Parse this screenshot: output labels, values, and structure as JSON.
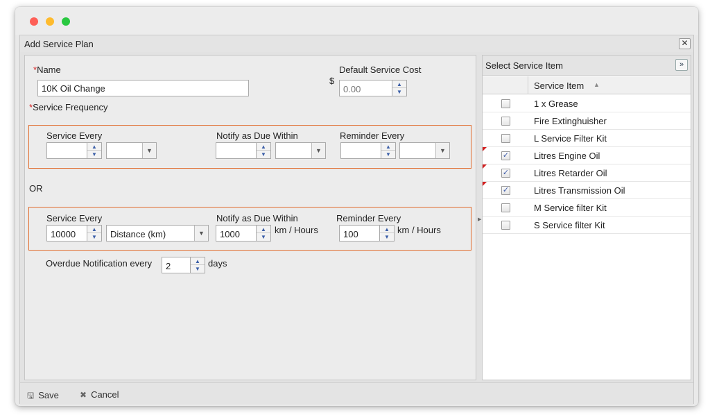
{
  "dialog": {
    "title": "Add Service Plan"
  },
  "name_field": {
    "label": "Name",
    "value": "10K Oil Change"
  },
  "cost_field": {
    "label": "Default Service Cost",
    "currency": "$",
    "value": "0.00"
  },
  "frequency_label": "Service Frequency",
  "or_label": "OR",
  "freq_time": {
    "service_every_label": "Service Every",
    "service_every_value": "",
    "service_unit_value": "",
    "notify_label": "Notify as Due Within",
    "notify_value": "",
    "notify_unit_value": "",
    "reminder_label": "Reminder Every",
    "reminder_value": "",
    "reminder_unit_value": ""
  },
  "freq_distance": {
    "service_every_label": "Service Every",
    "service_every_value": "10000",
    "service_unit_value": "Distance (km)",
    "notify_label": "Notify as Due Within",
    "notify_value": "1000",
    "notify_unit": "km / Hours",
    "reminder_label": "Reminder Every",
    "reminder_value": "100",
    "reminder_unit": "km / Hours"
  },
  "overdue": {
    "label": "Overdue Notification every",
    "value": "2",
    "unit": "days"
  },
  "service_items": {
    "title": "Select Service Item",
    "column_label": "Service Item",
    "items": [
      {
        "name": "1 x Grease",
        "checked": false,
        "modified": false
      },
      {
        "name": "Fire Extinghuisher",
        "checked": false,
        "modified": false
      },
      {
        "name": "L Service Filter Kit",
        "checked": false,
        "modified": false
      },
      {
        "name": "Litres Engine Oil",
        "checked": true,
        "modified": true
      },
      {
        "name": "Litres Retarder Oil",
        "checked": true,
        "modified": true
      },
      {
        "name": "Litres Transmission Oil",
        "checked": true,
        "modified": true
      },
      {
        "name": "M Service filter Kit",
        "checked": false,
        "modified": false
      },
      {
        "name": "S Service filter Kit",
        "checked": false,
        "modified": false
      }
    ]
  },
  "footer": {
    "save_label": "Save",
    "cancel_label": "Cancel"
  },
  "colors": {
    "accent_border": "#e06b2c",
    "required": "#d31f1f",
    "spinner_arrow": "#3c5fa8"
  },
  "icons": {
    "save": "floppy-disk-icon",
    "cancel": "x-icon",
    "close": "close-icon",
    "expand": "double-chevron-right-icon"
  }
}
